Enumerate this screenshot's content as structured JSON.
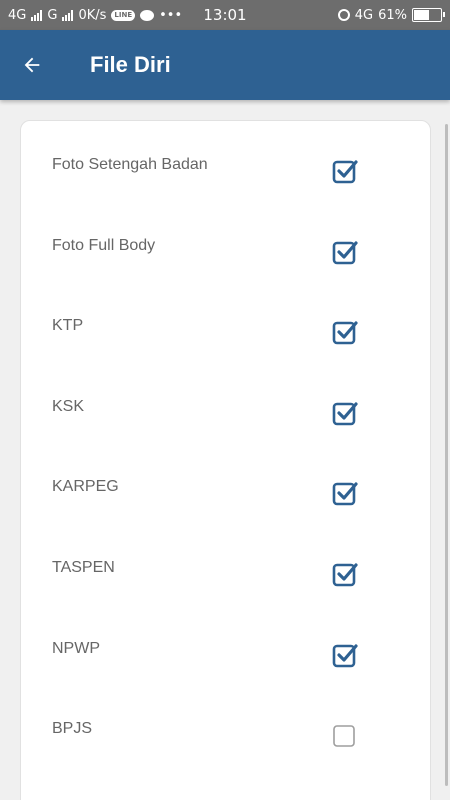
{
  "status_bar": {
    "net1": "4G",
    "net2": "G",
    "speed": "0K/s",
    "line_badge": "LINE",
    "more": "•••",
    "time": "13:01",
    "net3": "4G",
    "battery_level_percent": 61,
    "battery_text": "61%"
  },
  "header": {
    "title": "File Diri",
    "back_icon": "arrow-left-icon"
  },
  "colors": {
    "app_bar": "#2e6192",
    "checkbox": "#2e6192",
    "status_bar": "#6d6d6d"
  },
  "items": [
    {
      "label": "Foto Setengah Badan",
      "checked": true
    },
    {
      "label": "Foto Full Body",
      "checked": true
    },
    {
      "label": "KTP",
      "checked": true
    },
    {
      "label": "KSK",
      "checked": true
    },
    {
      "label": "KARPEG",
      "checked": true
    },
    {
      "label": "TASPEN",
      "checked": true
    },
    {
      "label": "NPWP",
      "checked": true
    },
    {
      "label": "BPJS",
      "checked": false
    }
  ]
}
